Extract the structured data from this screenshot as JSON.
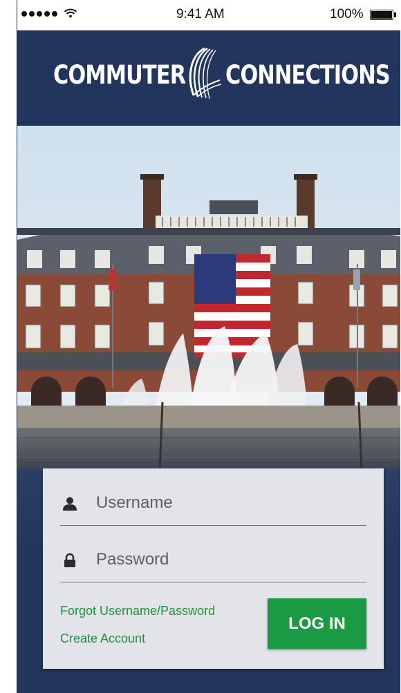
{
  "status_bar": {
    "time": "9:41 AM",
    "battery_label": "100%",
    "signal_icon": "signal-dots-icon",
    "wifi_icon": "wifi-icon",
    "battery_icon": "battery-icon"
  },
  "header": {
    "logo_left": "COMMUTER",
    "logo_right": "CONNECTIONS",
    "logo_registered": "®",
    "background_color": "#22365d"
  },
  "login": {
    "username_placeholder": "Username",
    "password_placeholder": "Password",
    "username_icon": "user-icon",
    "password_icon": "lock-icon",
    "forgot_link": "Forgot Username/Password",
    "create_link": "Create Account",
    "login_button": "LOG IN",
    "accent_color": "#1a9a43"
  }
}
